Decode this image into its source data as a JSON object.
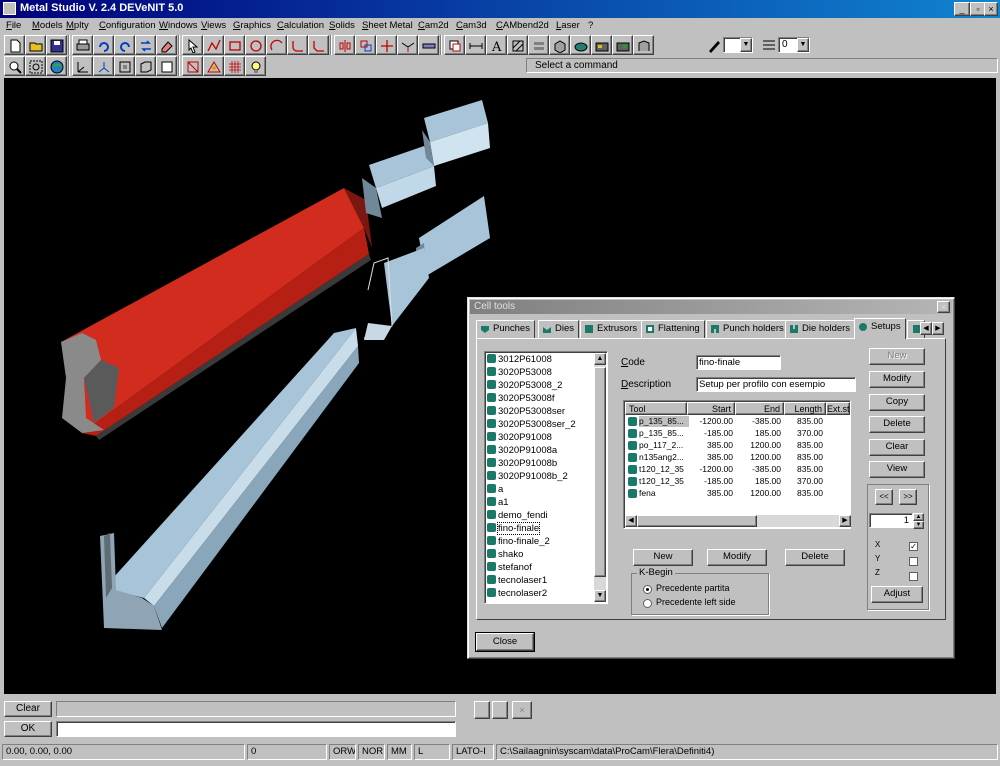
{
  "window": {
    "title": "Metal Studio V. 2.4 DEVeNIT 5.0"
  },
  "menu": [
    "File",
    "Models",
    "Mplty",
    "Configuration",
    "Windows",
    "Views",
    "Graphics",
    "Calculation",
    "Solids",
    "Sheet Metal",
    "Cam2d",
    "Cam3d",
    "CAMbend2d",
    "Laser",
    "?"
  ],
  "toolbar": {
    "color_value": "",
    "layer_value": "0"
  },
  "prompt": "Select a command",
  "dialog": {
    "title": "Cell tools",
    "close_glyph": "×",
    "tabs": [
      "Punches",
      "Dies",
      "Extrusors",
      "Flattening",
      "Punch holders",
      "Die holders",
      "Setups"
    ],
    "active_tab": "Setups",
    "list_items": [
      "3012P61008",
      "3020P53008",
      "3020P53008_2",
      "3020P53008f",
      "3020P53008ser",
      "3020P53008ser_2",
      "3020P91008",
      "3020P91008a",
      "3020P91008b",
      "3020P91008b_2",
      "a",
      "a1",
      "demo_fendi",
      "fino-finale",
      "fino-finale_2",
      "shako",
      "stefanof",
      "tecnolaser1",
      "tecnolaser2"
    ],
    "selected_item": "fino-finale",
    "code_label": "Code",
    "code_value": "fino-finale",
    "desc_label": "Description",
    "desc_value": "Setup per profilo con esempio",
    "table": {
      "headers": [
        "Tool",
        "Start",
        "End",
        "Length",
        "Ext.st"
      ],
      "rows": [
        [
          "p_135_85...",
          "-1200.00",
          "-385.00",
          "835.00"
        ],
        [
          "p_135_85...",
          "-185.00",
          "185.00",
          "370.00"
        ],
        [
          "po_117_2...",
          "385.00",
          "1200.00",
          "835.00"
        ],
        [
          "n135ang2...",
          "385.00",
          "1200.00",
          "835.00"
        ],
        [
          "t120_12_35",
          "-1200.00",
          "-385.00",
          "835.00"
        ],
        [
          "t120_12_35",
          "-185.00",
          "185.00",
          "370.00"
        ],
        [
          "fena",
          "385.00",
          "1200.00",
          "835.00"
        ]
      ]
    },
    "table_buttons": [
      "New",
      "Modify",
      "Delete"
    ],
    "right_buttons": [
      "New",
      "Modify",
      "Copy",
      "Delete",
      "Clear",
      "View"
    ],
    "prev_glyph": "<<",
    "next_glyph": ">>",
    "spin_value": "1",
    "axis_labels": [
      "X",
      "Y",
      "Z"
    ],
    "adjust_label": "Adjust",
    "group_title": "K-Begin",
    "radio_options": [
      "Precedente partita",
      "Precedente left side"
    ],
    "close_label": "Close"
  },
  "command": {
    "clear_label": "Clear",
    "ok_label": "OK",
    "input_value": ""
  },
  "status": {
    "coords": "0.00, 0.00, 0.00",
    "cell2": "0",
    "ortho": "ORW",
    "snap": "NOR",
    "mm": "MM",
    "l": "L",
    "lato": "LATO-I",
    "path": "C:\\Sailaagnin\\syscam\\data\\ProCam\\Flera\\Definiti4)"
  }
}
